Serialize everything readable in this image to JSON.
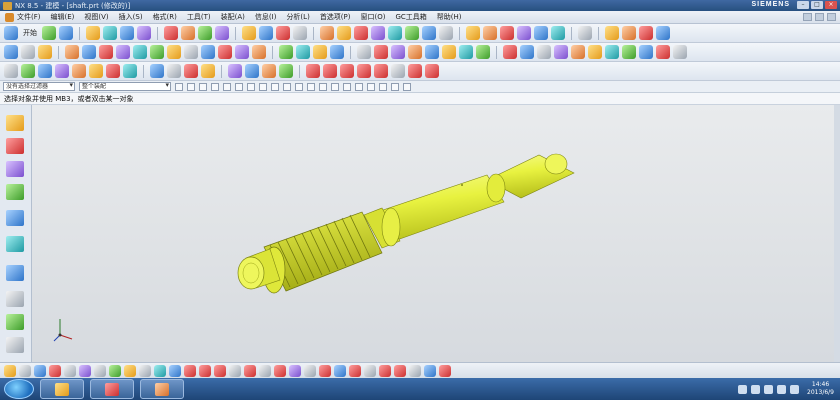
{
  "window": {
    "title": "NX 8.5 - 建模 - [shaft.prt (修改的)]",
    "brand": "SIEMENS",
    "controls": [
      "–",
      "□",
      "×"
    ]
  },
  "menu": {
    "items": [
      "文件(F)",
      "编辑(E)",
      "视图(V)",
      "插入(S)",
      "格式(R)",
      "工具(T)",
      "装配(A)",
      "信息(I)",
      "分析(L)",
      "首选项(P)",
      "窗口(O)",
      "GC工具箱",
      "帮助(H)"
    ]
  },
  "toolbar": {
    "start_label": "开始",
    "filter_value": "没有选择过滤器",
    "scope_value": "整个装配"
  },
  "cue_line": "选择对象并使用 MB3，或者双击某一对象",
  "taskbar": {
    "time": "14:46",
    "date": "2013/6/9"
  },
  "colors": {
    "part_face": "#e7f24a",
    "part_shadow": "#a9b21a",
    "viewport_bg": "#e3e6e9",
    "taskbar": "#2b5a94"
  },
  "icons": {
    "triad": "wcs-triad-icon",
    "start": "windows-start-icon"
  }
}
